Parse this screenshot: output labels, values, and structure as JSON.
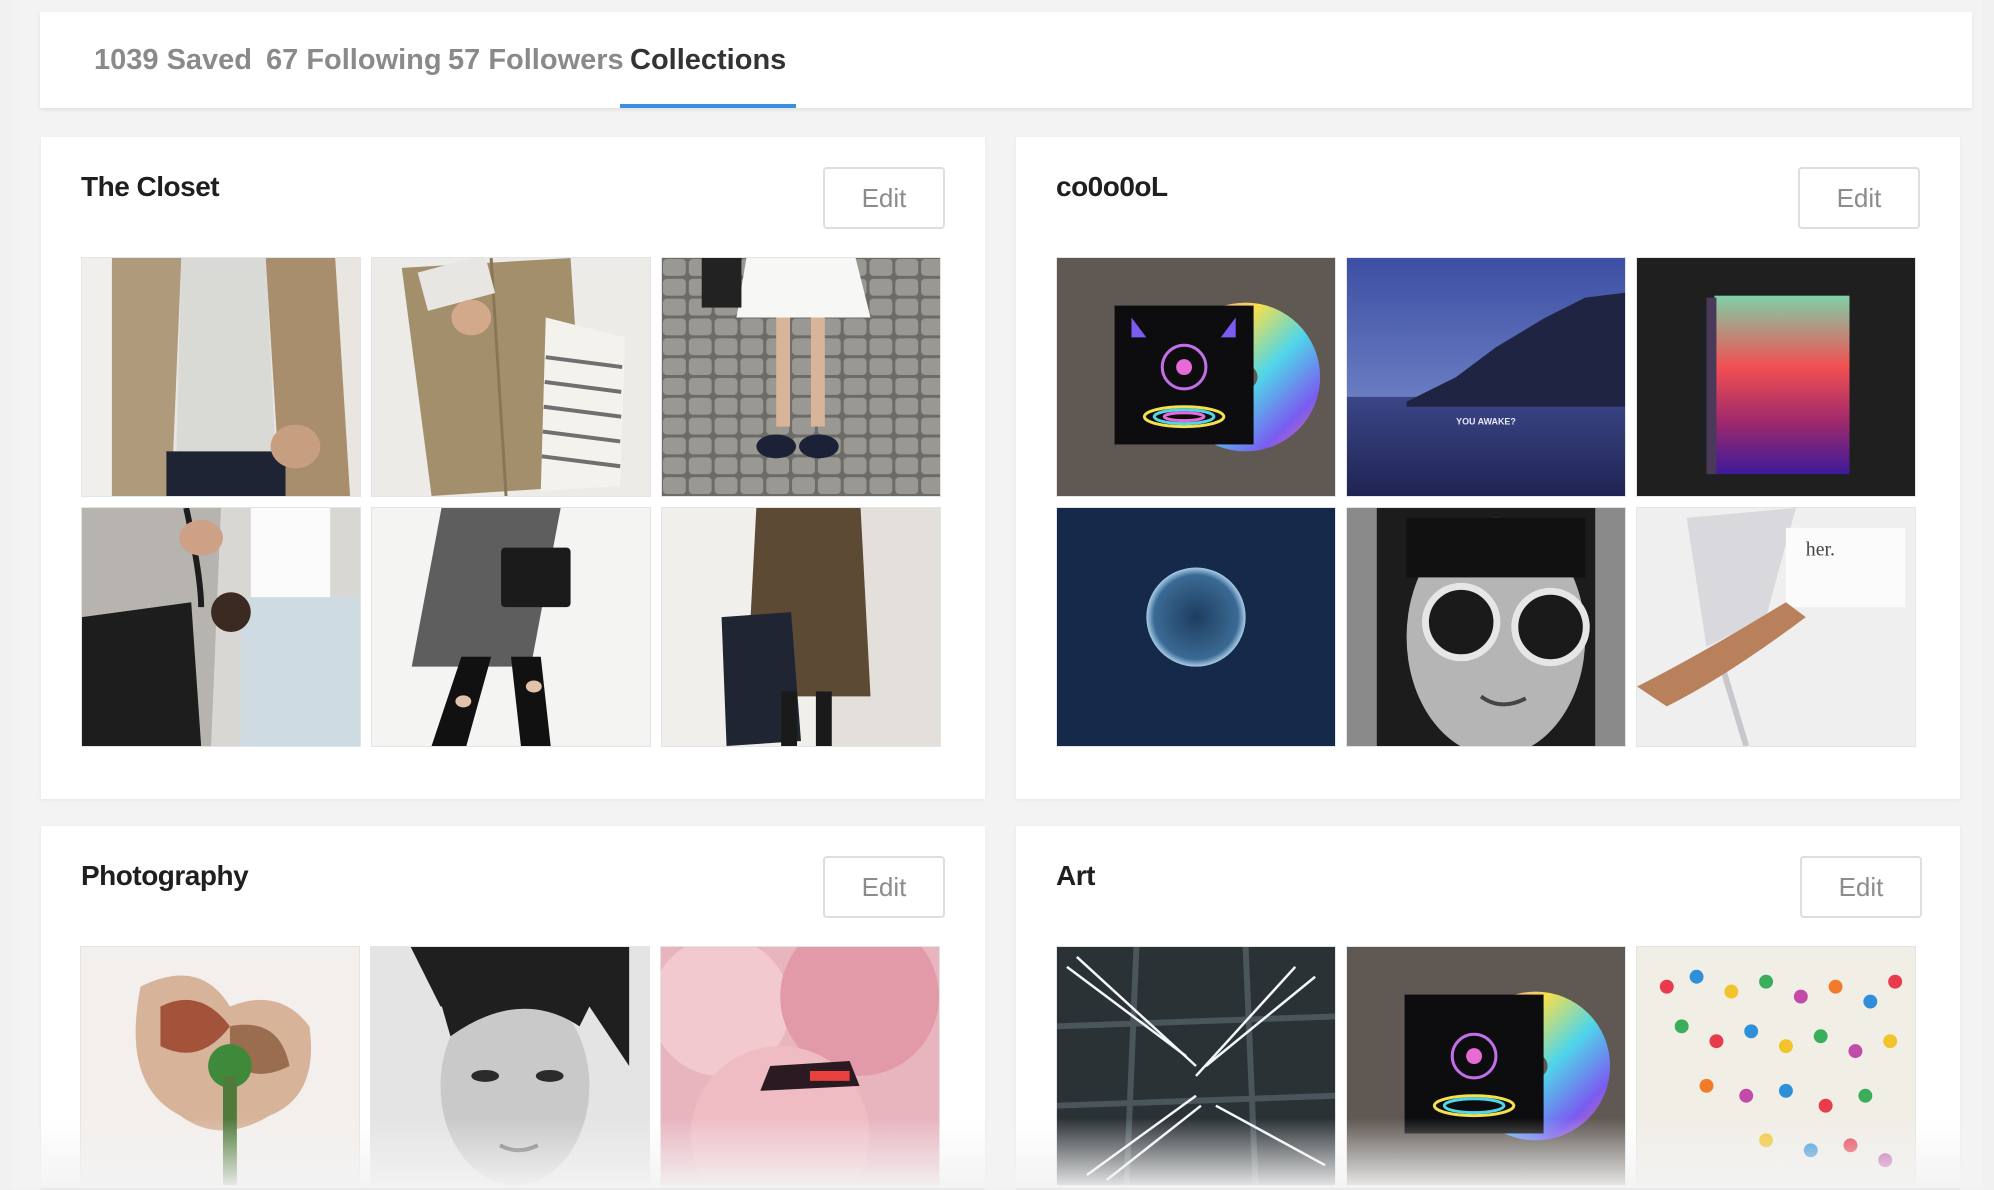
{
  "tabs": [
    {
      "label": "1039 Saved",
      "active": false
    },
    {
      "label": "67 Following",
      "active": false
    },
    {
      "label": "57 Followers",
      "active": false
    },
    {
      "label": "Collections",
      "active": true
    }
  ],
  "accent_color": "#3b8de0",
  "collections": [
    {
      "title": "The Closet",
      "edit_label": "Edit",
      "thumbnails": [
        "beige-blazer-white-tee",
        "khaki-parka-striped-tote",
        "white-skirt-cobblestone",
        "grey-cardigan-black-bag",
        "grey-coat-ripped-jeans",
        "olive-coat-navy-tote"
      ]
    },
    {
      "title": "co0o0oL",
      "edit_label": "Edit",
      "thumbnails": [
        "neon-album-holographic-cd",
        "night-cliffs-sea",
        "gradient-book",
        "blue-planet",
        "round-sunglasses-portrait",
        "white-bag-card"
      ]
    },
    {
      "title": "Photography",
      "edit_label": "Edit",
      "thumbnails": [
        "peach-flower",
        "bw-woman-portrait",
        "pink-smoke-car"
      ]
    },
    {
      "title": "Art",
      "edit_label": "Edit",
      "thumbnails": [
        "neon-light-building",
        "neon-album-holographic-cd",
        "paper-origami-field"
      ]
    }
  ],
  "thumbnail_texts": {
    "night_sky_caption": "YOU AWAKE?",
    "card_text": "her."
  }
}
